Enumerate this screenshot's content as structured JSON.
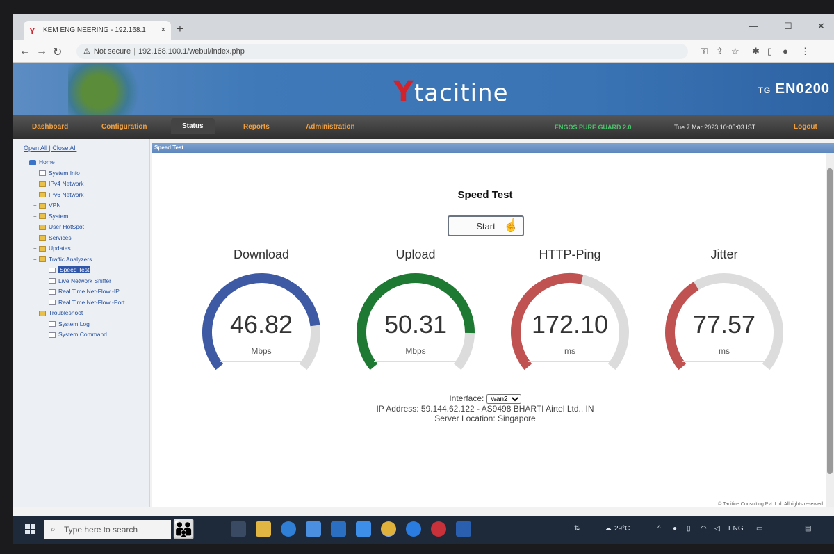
{
  "browser": {
    "tab_title": "KEM ENGINEERING - 192.168.1",
    "tab_close": "×",
    "new_tab": "+",
    "security_label": "Not secure",
    "url": "192.168.100.1/webui/index.php"
  },
  "banner": {
    "logo_initial": "Y",
    "logo_text": "tacitine",
    "model_prefix": "TG",
    "model": "EN0200"
  },
  "nav": {
    "items": [
      "Dashboard",
      "Configuration",
      "Status",
      "Reports",
      "Administration"
    ],
    "active": "Status",
    "status_text": "ENGOS PURE GUARD 2.0",
    "datetime": "Tue 7 Mar 2023 10:05:03 IST",
    "logout": "Logout"
  },
  "sidebar": {
    "toggle": "Open All | Close All",
    "items": [
      {
        "label": "Home",
        "type": "home",
        "depth": 0
      },
      {
        "label": "System Info",
        "type": "doc",
        "depth": 1
      },
      {
        "label": "IPv4 Network",
        "type": "folder",
        "depth": 1
      },
      {
        "label": "IPv6 Network",
        "type": "folder",
        "depth": 1
      },
      {
        "label": "VPN",
        "type": "folder",
        "depth": 1
      },
      {
        "label": "System",
        "type": "folder",
        "depth": 1
      },
      {
        "label": "User HotSpot",
        "type": "folder",
        "depth": 1
      },
      {
        "label": "Services",
        "type": "folder",
        "depth": 1
      },
      {
        "label": "Updates",
        "type": "folder",
        "depth": 1
      },
      {
        "label": "Traffic Analyzers",
        "type": "folder",
        "depth": 1
      },
      {
        "label": "Speed Test",
        "type": "doc",
        "depth": 2,
        "selected": true
      },
      {
        "label": "Live Network Sniffer",
        "type": "doc",
        "depth": 2
      },
      {
        "label": "Real Time Net-Flow -IP",
        "type": "doc",
        "depth": 2
      },
      {
        "label": "Real Time Net-Flow -Port",
        "type": "doc",
        "depth": 2
      },
      {
        "label": "Troubleshoot",
        "type": "folder",
        "depth": 1
      },
      {
        "label": "System Log",
        "type": "doc",
        "depth": 2
      },
      {
        "label": "System Command",
        "type": "doc",
        "depth": 2
      }
    ]
  },
  "main": {
    "panel_title": "Speed Test",
    "title": "Speed Test",
    "start_label": "Start",
    "gauges": [
      {
        "label": "Download",
        "value": "46.82",
        "unit": "Mbps",
        "fraction": 0.82,
        "color": "#3f5aa5"
      },
      {
        "label": "Upload",
        "value": "50.31",
        "unit": "Mbps",
        "fraction": 0.85,
        "color": "#1e7a32"
      },
      {
        "label": "HTTP-Ping",
        "value": "172.10",
        "unit": "ms",
        "fraction": 0.55,
        "color": "#c05252"
      },
      {
        "label": "Jitter",
        "value": "77.57",
        "unit": "ms",
        "fraction": 0.38,
        "color": "#c05252"
      }
    ],
    "interface_label": "Interface:",
    "interface_value": "wan2",
    "ip_line": "IP Address: 59.144.62.122 - AS9498 BHARTI Airtel Ltd., IN",
    "server_line": "Server Location: Singapore",
    "copyright": "© Tacitine Consulting Pvt. Ltd. All rights reserved."
  },
  "taskbar": {
    "search_placeholder": "Type here to search",
    "temperature": "29°C",
    "language": "ENG"
  }
}
